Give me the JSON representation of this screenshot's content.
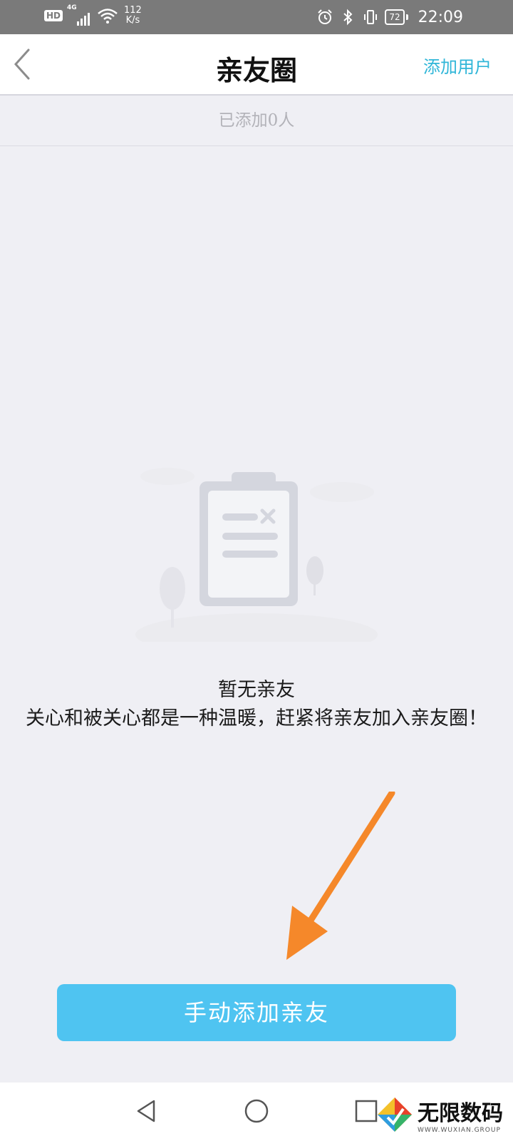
{
  "status_bar": {
    "hd": "HD",
    "network": "4G",
    "speed_value": "112",
    "speed_unit": "K/s",
    "battery": "72",
    "time": "22:09"
  },
  "header": {
    "title": "亲友圈",
    "add_user_label": "添加用户"
  },
  "count_text": "已添加0人",
  "empty_state": {
    "title": "暂无亲友",
    "description": "关心和被关心都是一种温暖，赶紧将亲友加入亲友圈！"
  },
  "add_manual_label": "手动添加亲友",
  "colors": {
    "accent_blue": "#4fc4f1",
    "link_blue": "#30b6d8",
    "arrow_orange": "#f5882a",
    "background": "#efeff4"
  },
  "watermark": {
    "main": "无限数码",
    "sub": "WWW.WUXIAN.GROUP"
  }
}
